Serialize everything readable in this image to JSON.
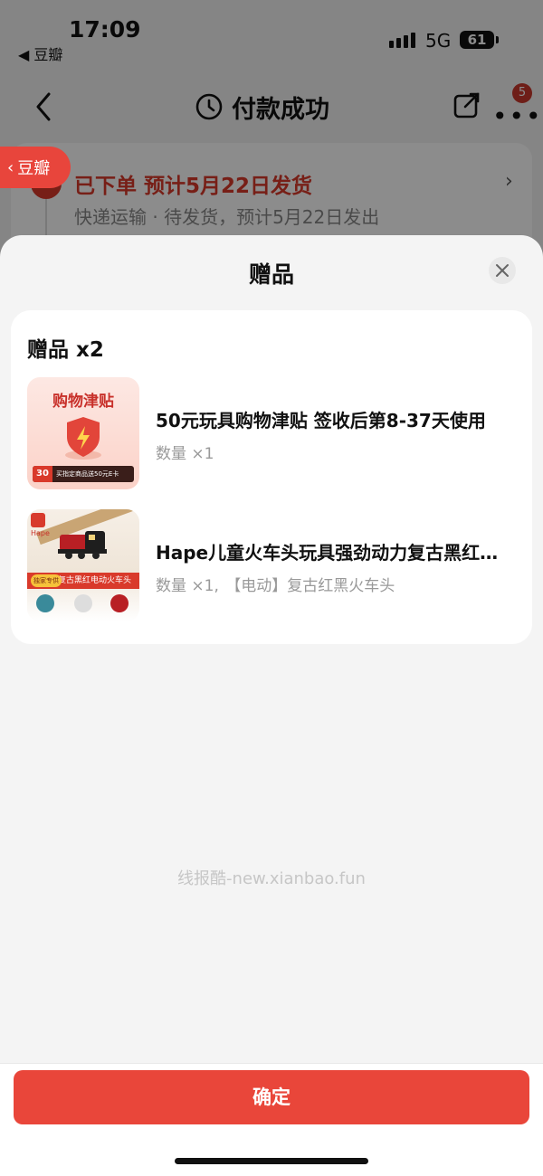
{
  "status_bar": {
    "time": "17:09",
    "back_app": "◀ 豆瓣",
    "network": "5G",
    "battery": "61"
  },
  "nav": {
    "title": "付款成功",
    "badge_count": "5"
  },
  "douban_pill": {
    "label": "豆瓣"
  },
  "order": {
    "status": "已下单  预计5月22日发货",
    "subtitle": "快递运输 · 待发货，预计5月22日发出"
  },
  "sheet": {
    "title": "赠品",
    "heading": "赠品 x2",
    "items": [
      {
        "name": "50元玩具购物津贴 签收后第8-37天使用",
        "meta": "数量 ×1",
        "thumb_title": "购物津贴",
        "thumb_chip": "30",
        "thumb_bar": "买指定商品送50元E卡"
      },
      {
        "name": "Hape儿童火车头玩具强劲动力复古黑红电动火车头",
        "meta": "数量 ×1,",
        "variant": "【电动】复古红黑火车头",
        "thumb_brand": "Hape",
        "thumb_label": "复古黑红电动火车头",
        "thumb_pill": "独家专供"
      }
    ],
    "watermark": "线报酷-new.xianbao.fun",
    "confirm": "确定"
  },
  "colors": {
    "accent": "#e9463a",
    "status_red": "#d93a2b"
  }
}
